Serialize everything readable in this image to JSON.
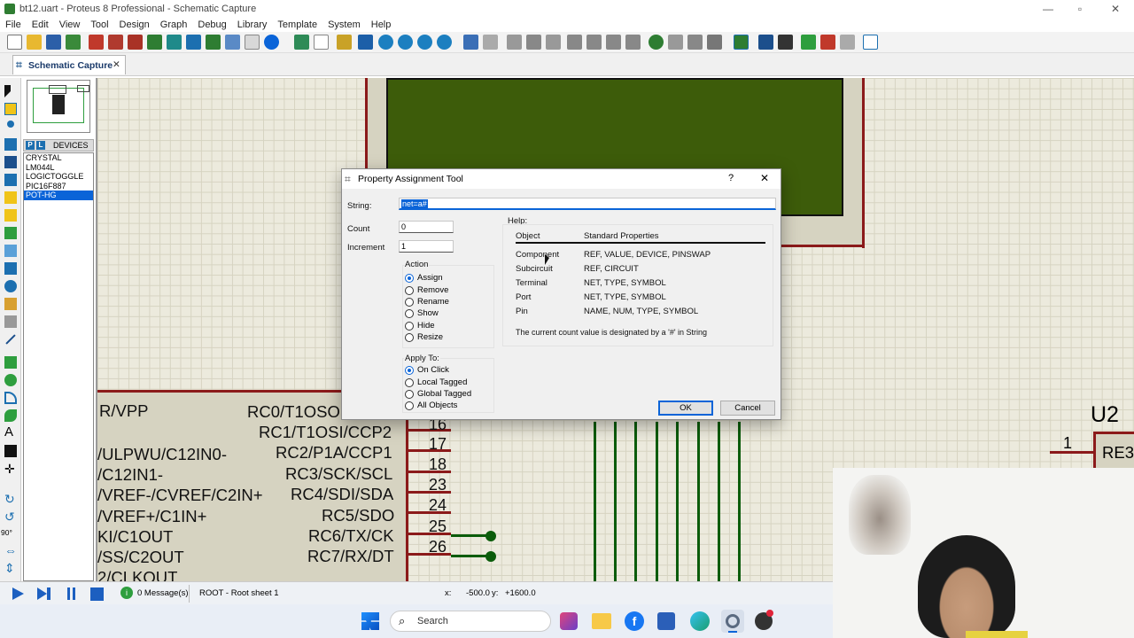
{
  "window": {
    "title": "bt12.uart - Proteus 8 Professional - Schematic Capture"
  },
  "menu": [
    "File",
    "Edit",
    "View",
    "Tool",
    "Design",
    "Graph",
    "Debug",
    "Library",
    "Template",
    "System",
    "Help"
  ],
  "tab": {
    "label": "Schematic Capture",
    "close": "✕"
  },
  "devices": {
    "header_p": "P",
    "header_l": "L",
    "header": "DEVICES",
    "items": [
      "CRYSTAL",
      "LM044L",
      "LOGICTOGGLE",
      "PIC16F887",
      "POT-HG"
    ],
    "selected": "POT-HG"
  },
  "rotation": "90°",
  "schematic": {
    "left_pins": [
      "R/VPP",
      "/ULPWU/C12IN0-",
      "/C12IN1-",
      "/VREF-/CVREF/C2IN+",
      "/VREF+/C1IN+",
      "KI/C1OUT",
      "/SS/C2OUT",
      "2/CLKOUT"
    ],
    "right_pins": [
      "RC0/T1OSO",
      "RC1/T1OSI/CCP2",
      "RC2/P1A/CCP1",
      "RC3/SCK/SCL",
      "RC4/SDI/SDA",
      "RC5/SDO",
      "RC6/TX/CK",
      "RC7/RX/DT"
    ],
    "pin_numbers": [
      "16",
      "17",
      "18",
      "23",
      "24",
      "25",
      "26"
    ],
    "u2_label": "U2",
    "u2_pin": "1",
    "u2_pin_label": "RE3"
  },
  "dialog": {
    "title": "Property Assignment Tool",
    "help_btn": "?",
    "close": "✕",
    "string_label": "String:",
    "string_value": "net=a#",
    "count_label": "Count",
    "count_value": "0",
    "increment_label": "Increment",
    "increment_value": "1",
    "action_label": "Action",
    "actions": [
      "Assign",
      "Remove",
      "Rename",
      "Show",
      "Hide",
      "Resize"
    ],
    "action_selected": "Assign",
    "apply_label": "Apply To:",
    "apply": [
      "On Click",
      "Local Tagged",
      "Global Tagged",
      "All Objects"
    ],
    "apply_selected": "On Click",
    "help_label": "Help:",
    "help_headers": [
      "Object",
      "Standard Properties"
    ],
    "help_rows": [
      [
        "Component",
        "REF, VALUE, DEVICE, PINSWAP"
      ],
      [
        "Subcircuit",
        "REF, CIRCUIT"
      ],
      [
        "Terminal",
        "NET, TYPE, SYMBOL"
      ],
      [
        "Port",
        "NET, TYPE, SYMBOL"
      ],
      [
        "Pin",
        "NAME, NUM, TYPE, SYMBOL"
      ]
    ],
    "help_note": "The current count value is designated by a '#' in String",
    "ok": "OK",
    "cancel": "Cancel"
  },
  "status": {
    "messages": "0 Message(s)",
    "sheet": "ROOT - Root sheet 1",
    "x_label": "x:",
    "x": "-500.0",
    "y_label": "y:",
    "y": "+1600.0"
  },
  "taskbar": {
    "search": "Search"
  }
}
